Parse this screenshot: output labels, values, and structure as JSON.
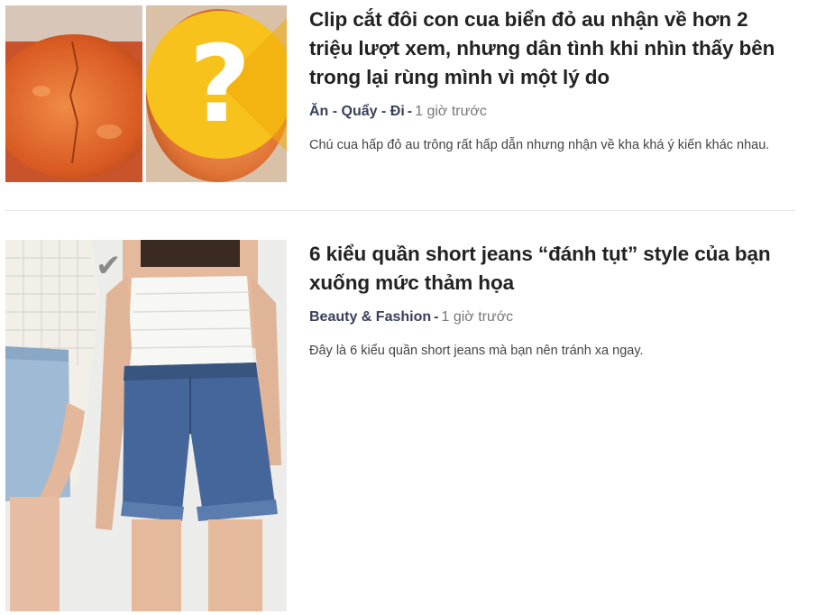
{
  "articles": [
    {
      "title": "Clip cắt đôi con cua biển đỏ au nhận về hơn 2 triệu lượt xem, nhưng dân tình khi nhìn thấy bên trong lại rùng mình vì một lý do",
      "category": "Ăn - Quẩy - Đi",
      "separator": "-",
      "time": "1 giờ trước",
      "summary": "Chú cua hấp đỏ au trông rất hấp dẫn nhưng nhận về kha khá ý kiến khác nhau.",
      "thumbnail": {
        "overlay_glyph": "?",
        "badge_color": "#f7c21b",
        "crab_color": "#e0622a"
      }
    },
    {
      "title": "6 kiểu quần short jeans “đánh tụt” style của bạn xuống mức thảm họa",
      "category": "Beauty & Fashion",
      "separator": "-",
      "time": "1 giờ trước",
      "summary": "Đây là 6 kiểu quần short jeans mà bạn nên tránh xa ngay.",
      "thumbnail": {
        "overlay_glyph": "✔",
        "denim_color": "#3f5f8e",
        "top_color": "#f4f4f2"
      }
    }
  ]
}
